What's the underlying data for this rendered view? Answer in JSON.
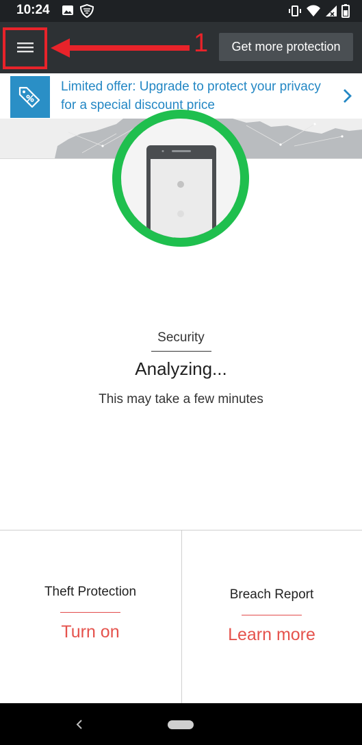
{
  "status_bar": {
    "time": "10:24",
    "icons": [
      "image-icon",
      "shield-icon",
      "vibrate-icon",
      "wifi-icon",
      "signal-icon",
      "battery-icon"
    ]
  },
  "app_bar": {
    "menu_icon": "hamburger-menu-icon",
    "annotation_number": "1",
    "get_protection_label": "Get more protection"
  },
  "offer": {
    "icon": "discount-tag-icon",
    "text": "Limited offer: Upgrade to protect your privacy for a special discount price"
  },
  "scan": {
    "label": "Security",
    "status": "Analyzing...",
    "hint": "This may take a few minutes"
  },
  "tiles": [
    {
      "title": "Theft Protection",
      "action": "Turn on"
    },
    {
      "title": "Breach Report",
      "action": "Learn more"
    }
  ],
  "colors": {
    "accent_blue": "#2387c4",
    "ring_green": "#1fbf4e",
    "action_red": "#e5524c",
    "annotation_red": "#e8232a"
  }
}
